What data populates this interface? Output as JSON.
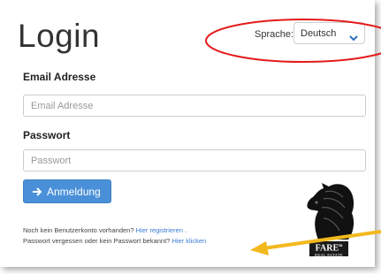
{
  "header": {
    "title": "Login",
    "language_label": "Sprache:",
    "language_value": "Deutsch"
  },
  "form": {
    "email_label": "Email Adresse",
    "email_placeholder": "Email Adresse",
    "email_value": "",
    "password_label": "Passwort",
    "password_placeholder": "Passwort",
    "password_value": "",
    "submit_label": "Anmeldung"
  },
  "links": {
    "register_prefix": "Noch kein Benutzerkonto vorhanden?",
    "register_link": "Hier registrieren",
    "register_suffix": ".",
    "forgot_prefix": "Passwort vergessen oder kein Passwort bekannt?",
    "forgot_link": "Hier klicken"
  },
  "logo": {
    "name": "FARE",
    "superscript": "to",
    "subtitle": "REAL ESTATE"
  },
  "colors": {
    "primary": "#4a90d9",
    "link": "#3a7bd5",
    "annotation_red": "#e41b1b",
    "annotation_arrow": "#f2b81d"
  }
}
